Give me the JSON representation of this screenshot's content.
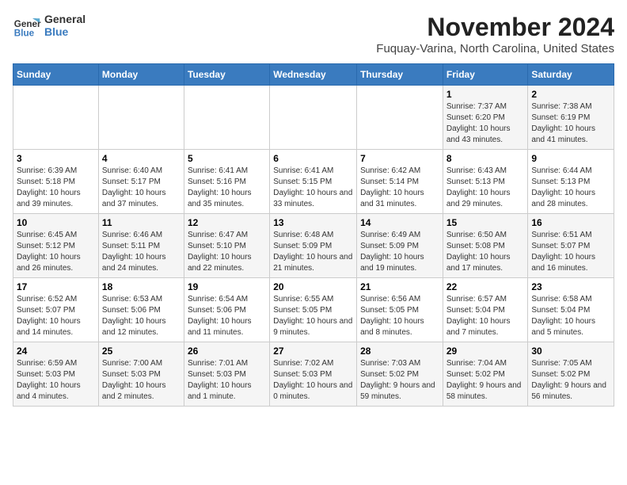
{
  "header": {
    "logo_line1": "General",
    "logo_line2": "Blue",
    "month_title": "November 2024",
    "location": "Fuquay-Varina, North Carolina, United States"
  },
  "weekdays": [
    "Sunday",
    "Monday",
    "Tuesday",
    "Wednesday",
    "Thursday",
    "Friday",
    "Saturday"
  ],
  "weeks": [
    [
      {
        "day": "",
        "info": ""
      },
      {
        "day": "",
        "info": ""
      },
      {
        "day": "",
        "info": ""
      },
      {
        "day": "",
        "info": ""
      },
      {
        "day": "",
        "info": ""
      },
      {
        "day": "1",
        "info": "Sunrise: 7:37 AM\nSunset: 6:20 PM\nDaylight: 10 hours and 43 minutes."
      },
      {
        "day": "2",
        "info": "Sunrise: 7:38 AM\nSunset: 6:19 PM\nDaylight: 10 hours and 41 minutes."
      }
    ],
    [
      {
        "day": "3",
        "info": "Sunrise: 6:39 AM\nSunset: 5:18 PM\nDaylight: 10 hours and 39 minutes."
      },
      {
        "day": "4",
        "info": "Sunrise: 6:40 AM\nSunset: 5:17 PM\nDaylight: 10 hours and 37 minutes."
      },
      {
        "day": "5",
        "info": "Sunrise: 6:41 AM\nSunset: 5:16 PM\nDaylight: 10 hours and 35 minutes."
      },
      {
        "day": "6",
        "info": "Sunrise: 6:41 AM\nSunset: 5:15 PM\nDaylight: 10 hours and 33 minutes."
      },
      {
        "day": "7",
        "info": "Sunrise: 6:42 AM\nSunset: 5:14 PM\nDaylight: 10 hours and 31 minutes."
      },
      {
        "day": "8",
        "info": "Sunrise: 6:43 AM\nSunset: 5:13 PM\nDaylight: 10 hours and 29 minutes."
      },
      {
        "day": "9",
        "info": "Sunrise: 6:44 AM\nSunset: 5:13 PM\nDaylight: 10 hours and 28 minutes."
      }
    ],
    [
      {
        "day": "10",
        "info": "Sunrise: 6:45 AM\nSunset: 5:12 PM\nDaylight: 10 hours and 26 minutes."
      },
      {
        "day": "11",
        "info": "Sunrise: 6:46 AM\nSunset: 5:11 PM\nDaylight: 10 hours and 24 minutes."
      },
      {
        "day": "12",
        "info": "Sunrise: 6:47 AM\nSunset: 5:10 PM\nDaylight: 10 hours and 22 minutes."
      },
      {
        "day": "13",
        "info": "Sunrise: 6:48 AM\nSunset: 5:09 PM\nDaylight: 10 hours and 21 minutes."
      },
      {
        "day": "14",
        "info": "Sunrise: 6:49 AM\nSunset: 5:09 PM\nDaylight: 10 hours and 19 minutes."
      },
      {
        "day": "15",
        "info": "Sunrise: 6:50 AM\nSunset: 5:08 PM\nDaylight: 10 hours and 17 minutes."
      },
      {
        "day": "16",
        "info": "Sunrise: 6:51 AM\nSunset: 5:07 PM\nDaylight: 10 hours and 16 minutes."
      }
    ],
    [
      {
        "day": "17",
        "info": "Sunrise: 6:52 AM\nSunset: 5:07 PM\nDaylight: 10 hours and 14 minutes."
      },
      {
        "day": "18",
        "info": "Sunrise: 6:53 AM\nSunset: 5:06 PM\nDaylight: 10 hours and 12 minutes."
      },
      {
        "day": "19",
        "info": "Sunrise: 6:54 AM\nSunset: 5:06 PM\nDaylight: 10 hours and 11 minutes."
      },
      {
        "day": "20",
        "info": "Sunrise: 6:55 AM\nSunset: 5:05 PM\nDaylight: 10 hours and 9 minutes."
      },
      {
        "day": "21",
        "info": "Sunrise: 6:56 AM\nSunset: 5:05 PM\nDaylight: 10 hours and 8 minutes."
      },
      {
        "day": "22",
        "info": "Sunrise: 6:57 AM\nSunset: 5:04 PM\nDaylight: 10 hours and 7 minutes."
      },
      {
        "day": "23",
        "info": "Sunrise: 6:58 AM\nSunset: 5:04 PM\nDaylight: 10 hours and 5 minutes."
      }
    ],
    [
      {
        "day": "24",
        "info": "Sunrise: 6:59 AM\nSunset: 5:03 PM\nDaylight: 10 hours and 4 minutes."
      },
      {
        "day": "25",
        "info": "Sunrise: 7:00 AM\nSunset: 5:03 PM\nDaylight: 10 hours and 2 minutes."
      },
      {
        "day": "26",
        "info": "Sunrise: 7:01 AM\nSunset: 5:03 PM\nDaylight: 10 hours and 1 minute."
      },
      {
        "day": "27",
        "info": "Sunrise: 7:02 AM\nSunset: 5:03 PM\nDaylight: 10 hours and 0 minutes."
      },
      {
        "day": "28",
        "info": "Sunrise: 7:03 AM\nSunset: 5:02 PM\nDaylight: 9 hours and 59 minutes."
      },
      {
        "day": "29",
        "info": "Sunrise: 7:04 AM\nSunset: 5:02 PM\nDaylight: 9 hours and 58 minutes."
      },
      {
        "day": "30",
        "info": "Sunrise: 7:05 AM\nSunset: 5:02 PM\nDaylight: 9 hours and 56 minutes."
      }
    ]
  ]
}
